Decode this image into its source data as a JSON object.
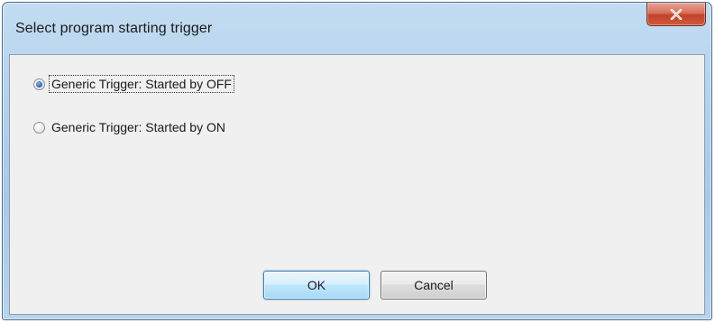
{
  "window": {
    "title": "Select program starting trigger",
    "close_icon": "close-x-icon"
  },
  "options": [
    {
      "label": "Generic Trigger: Started by OFF",
      "checked": true,
      "focused": true
    },
    {
      "label": "Generic Trigger: Started by ON",
      "checked": false,
      "focused": false
    }
  ],
  "buttons": {
    "ok_label": "OK",
    "cancel_label": "Cancel",
    "default": "OK"
  },
  "colors": {
    "accent": "#3c7fb1",
    "close_button": "#c2432a",
    "client_background": "#f0f0f0"
  }
}
